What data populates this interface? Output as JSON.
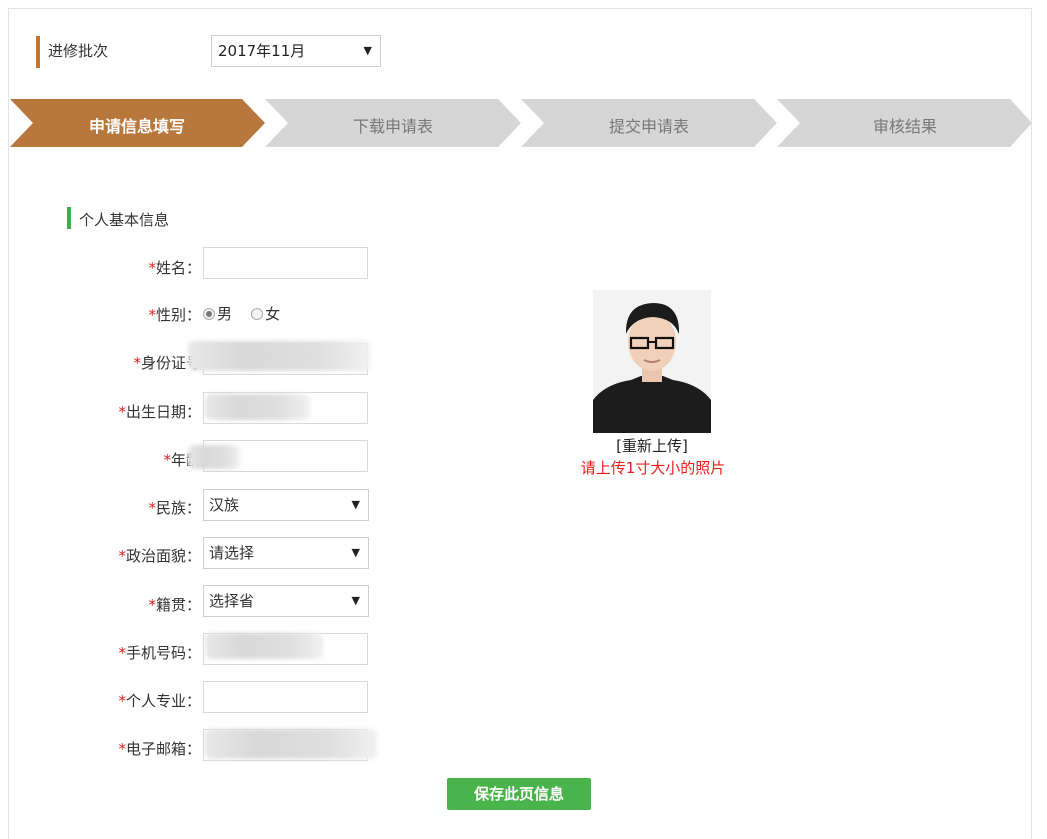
{
  "batch": {
    "label": "进修批次",
    "selected": "2017年11月"
  },
  "steps": [
    {
      "label": "申请信息填写",
      "active": true
    },
    {
      "label": "下载申请表",
      "active": false
    },
    {
      "label": "提交申请表",
      "active": false
    },
    {
      "label": "审核结果",
      "active": false
    }
  ],
  "section": {
    "title": "个人基本信息"
  },
  "form": {
    "required_mark": "*",
    "name_label": "姓名：",
    "gender_label": "性别：",
    "gender_male": "男",
    "gender_female": "女",
    "id_label": "身份证号",
    "birth_label": "出生日期：",
    "age_label": "年龄",
    "ethnic_label": "民族：",
    "ethnic_value": "汉族",
    "political_label": "政治面貌：",
    "political_value": "请选择",
    "native_label": "籍贯：",
    "native_value": "选择省",
    "phone_label": "手机号码：",
    "major_label": "个人专业：",
    "email_label": "电子邮箱："
  },
  "photo": {
    "reupload": "[重新上传]",
    "hint": "请上传1寸大小的照片"
  },
  "save_button": "保存此页信息",
  "colors": {
    "step_active": "#b8773c",
    "step_idle": "#d9d9d9",
    "accent_green": "#49b44c",
    "required_red": "#e02020"
  }
}
